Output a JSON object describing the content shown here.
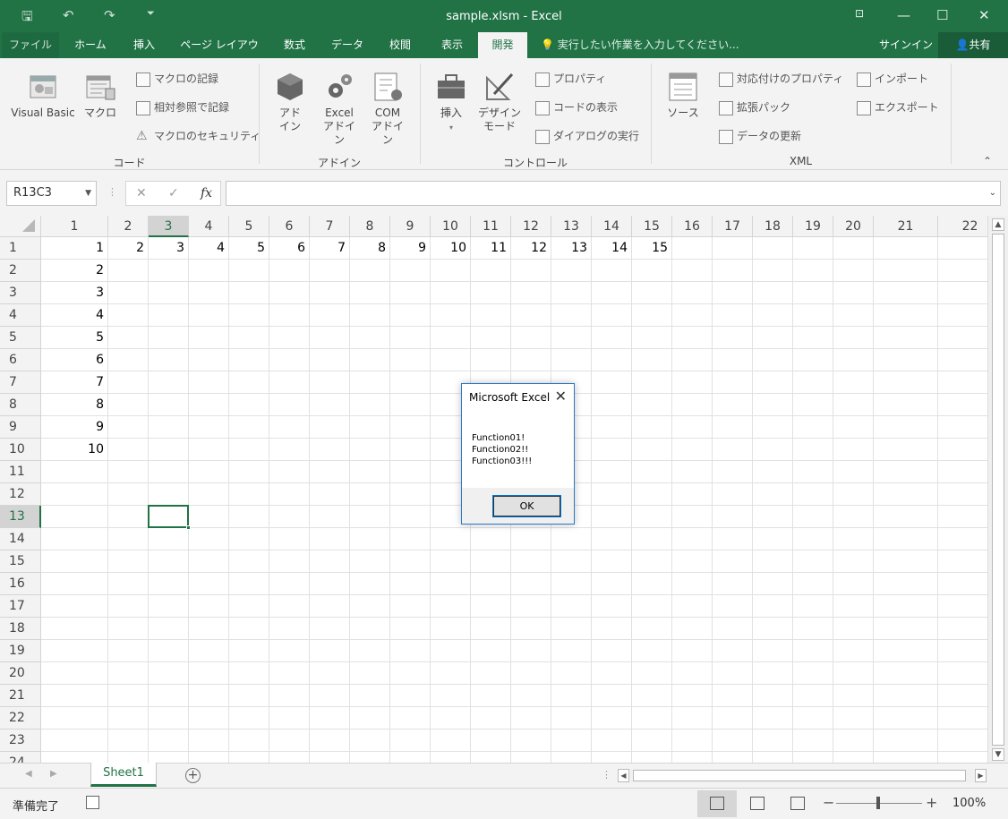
{
  "window": {
    "title": "sample.xlsm - Excel"
  },
  "ribbon_tabs": [
    {
      "label": "ファイル"
    },
    {
      "label": "ホーム"
    },
    {
      "label": "挿入"
    },
    {
      "label": "ページ レイアウト"
    },
    {
      "label": "数式"
    },
    {
      "label": "データ"
    },
    {
      "label": "校閲"
    },
    {
      "label": "表示"
    },
    {
      "label": "開発"
    }
  ],
  "active_tab": "開発",
  "tell_me": "実行したい作業を入力してください...",
  "sign_in": "サインイン",
  "share": "共有",
  "ribbon": {
    "code": {
      "visual_basic": "Visual Basic",
      "macro": "マクロ",
      "record_macro": "マクロの記録",
      "relative_ref": "相対参照で記録",
      "macro_security": "マクロのセキュリティ",
      "group_label": "コード"
    },
    "addins": {
      "addin": [
        "アド",
        "イン"
      ],
      "excel_addin": [
        "Excel",
        "アドイン"
      ],
      "com_addin": [
        "COM",
        "アドイン"
      ],
      "group_label": "アドイン"
    },
    "controls": {
      "insert": "挿入",
      "design_mode": [
        "デザイン",
        "モード"
      ],
      "properties": "プロパティ",
      "view_code": "コードの表示",
      "run_dialog": "ダイアログの実行",
      "group_label": "コントロール"
    },
    "xml": {
      "source": "ソース",
      "map_properties": "対応付けのプロパティ",
      "expansion_packs": "拡張パック",
      "refresh_data": "データの更新",
      "import": "インポート",
      "export": "エクスポート",
      "group_label": "XML"
    }
  },
  "formula_bar": {
    "name_box": "R13C3",
    "cancel": "✕",
    "enter": "✓",
    "fx": "fx",
    "value": ""
  },
  "grid": {
    "columns": [
      "1",
      "2",
      "3",
      "4",
      "5",
      "6",
      "7",
      "8",
      "9",
      "10",
      "11",
      "12",
      "13",
      "14",
      "15",
      "16",
      "17",
      "18",
      "19",
      "20",
      "21",
      "22"
    ],
    "rows": [
      "1",
      "2",
      "3",
      "4",
      "5",
      "6",
      "7",
      "8",
      "9",
      "10",
      "11",
      "12",
      "13",
      "14",
      "15",
      "16",
      "17",
      "18",
      "19",
      "20",
      "21",
      "22",
      "23",
      "24"
    ],
    "selected_cell": {
      "row": 13,
      "col": 3
    },
    "cells": [
      {
        "r": 1,
        "c": 1,
        "v": "1"
      },
      {
        "r": 1,
        "c": 2,
        "v": "2"
      },
      {
        "r": 1,
        "c": 3,
        "v": "3"
      },
      {
        "r": 1,
        "c": 4,
        "v": "4"
      },
      {
        "r": 1,
        "c": 5,
        "v": "5"
      },
      {
        "r": 1,
        "c": 6,
        "v": "6"
      },
      {
        "r": 1,
        "c": 7,
        "v": "7"
      },
      {
        "r": 1,
        "c": 8,
        "v": "8"
      },
      {
        "r": 1,
        "c": 9,
        "v": "9"
      },
      {
        "r": 1,
        "c": 10,
        "v": "10"
      },
      {
        "r": 1,
        "c": 11,
        "v": "11"
      },
      {
        "r": 1,
        "c": 12,
        "v": "12"
      },
      {
        "r": 1,
        "c": 13,
        "v": "13"
      },
      {
        "r": 1,
        "c": 14,
        "v": "14"
      },
      {
        "r": 1,
        "c": 15,
        "v": "15"
      },
      {
        "r": 2,
        "c": 1,
        "v": "2"
      },
      {
        "r": 3,
        "c": 1,
        "v": "3"
      },
      {
        "r": 4,
        "c": 1,
        "v": "4"
      },
      {
        "r": 5,
        "c": 1,
        "v": "5"
      },
      {
        "r": 6,
        "c": 1,
        "v": "6"
      },
      {
        "r": 7,
        "c": 1,
        "v": "7"
      },
      {
        "r": 8,
        "c": 1,
        "v": "8"
      },
      {
        "r": 9,
        "c": 1,
        "v": "9"
      },
      {
        "r": 10,
        "c": 1,
        "v": "10"
      }
    ]
  },
  "sheet_tabs": [
    {
      "label": "Sheet1"
    }
  ],
  "status": {
    "ready": "準備完了",
    "zoom": "100%"
  },
  "dialog": {
    "title": "Microsoft Excel",
    "lines": [
      "Function01!",
      "Function02!!",
      "Function03!!!"
    ],
    "ok_label": "OK"
  },
  "colors": {
    "accent": "#217346",
    "dialog_border": "#2b78c5"
  }
}
